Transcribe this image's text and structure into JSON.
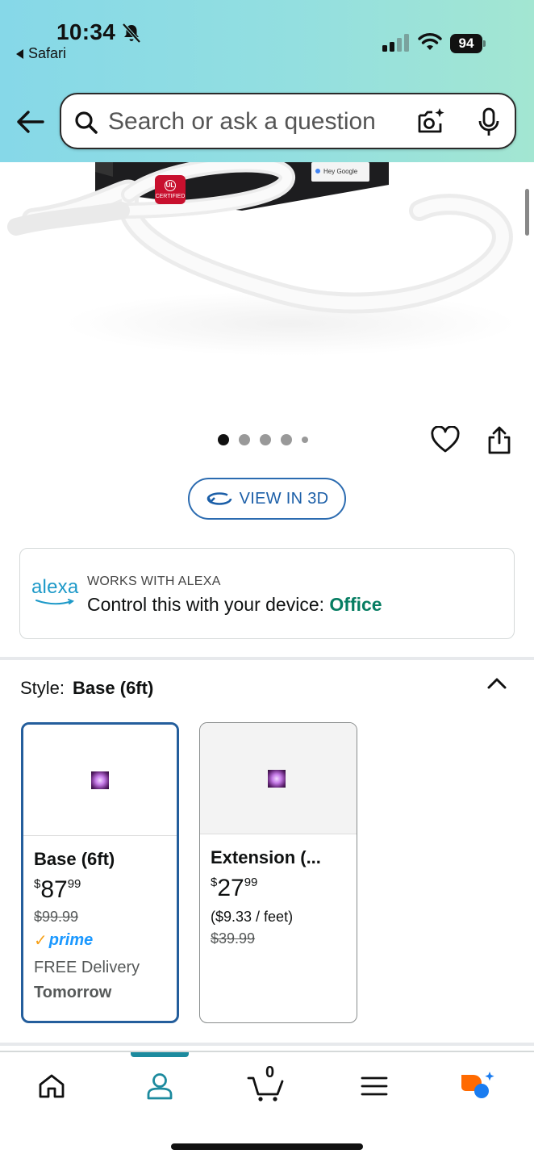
{
  "status_bar": {
    "time": "10:34",
    "back_app": "Safari",
    "battery": "94",
    "icons": [
      "bell-slash-icon",
      "signal-icon",
      "wifi-icon",
      "battery-icon"
    ]
  },
  "header": {
    "search_placeholder": "Search or ask a question",
    "icons": [
      "back-arrow-icon",
      "search-icon",
      "camera-icon",
      "mic-icon"
    ]
  },
  "product_image": {
    "icons": [
      "ul-certified-badge-icon",
      "google-assistant-icon"
    ],
    "badge_text": "CERTIFIED",
    "box_text": "Hey Google"
  },
  "gallery": {
    "dot_count": 5,
    "active_index": 0
  },
  "view_3d": {
    "label": "VIEW IN 3D"
  },
  "alexa": {
    "logo_text": "alexa",
    "eyebrow": "WORKS WITH ALEXA",
    "message": "Control this with your device: ",
    "device": "Office"
  },
  "style": {
    "label": "Style:",
    "selected_value": "Base (6ft)",
    "options": [
      {
        "name": "Base (6ft)",
        "price_dollars": "87",
        "price_cents": "99",
        "list_price": "$99.99",
        "prime": "prime",
        "delivery": "FREE Delivery",
        "delivery_when": "Tomorrow"
      },
      {
        "name": "Extension (...",
        "price_dollars": "27",
        "price_cents": "99",
        "unit_price": "($9.33 / feet)",
        "list_price": "$39.99"
      }
    ]
  },
  "tabbar": {
    "items": [
      "home-icon",
      "account-icon",
      "cart-icon",
      "menu-icon",
      "rufus-icon"
    ],
    "active": "account-icon",
    "cart_count": "0"
  },
  "colors": {
    "header_gradient_start": "#86d8e8",
    "header_gradient_end": "#a3e6d2",
    "accent_blue": "#245e9c",
    "alexa_green": "#067d62",
    "prime_blue": "#1a98ff",
    "tab_active": "#1c8a9e"
  }
}
